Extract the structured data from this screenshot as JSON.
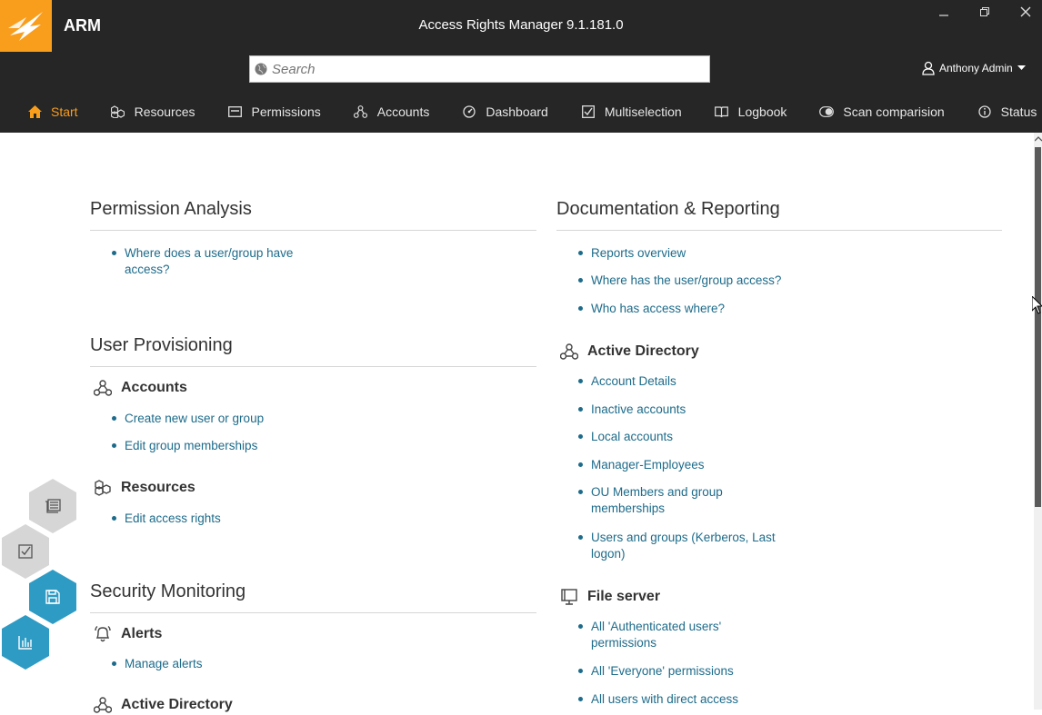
{
  "app": {
    "name": "ARM",
    "window_title": "Access Rights Manager  9.1.181.0",
    "brand_color": "#f99d1c",
    "link_color": "#1d6b8a"
  },
  "search": {
    "placeholder": "Search"
  },
  "user": {
    "name": "Anthony Admin"
  },
  "nav": [
    {
      "label": "Start",
      "icon": "home-icon",
      "active": true
    },
    {
      "label": "Resources",
      "icon": "resources-icon"
    },
    {
      "label": "Permissions",
      "icon": "permissions-icon"
    },
    {
      "label": "Accounts",
      "icon": "accounts-icon"
    },
    {
      "label": "Dashboard",
      "icon": "dashboard-icon"
    },
    {
      "label": "Multiselection",
      "icon": "checkbox-icon"
    },
    {
      "label": "Logbook",
      "icon": "book-icon"
    },
    {
      "label": "Scan comparision",
      "icon": "toggle-icon"
    },
    {
      "label": "Status",
      "icon": "info-icon"
    }
  ],
  "left": {
    "permission_analysis": {
      "title": "Permission Analysis",
      "links": [
        "Where does a user/group have",
        "access?"
      ]
    },
    "user_provisioning": {
      "title": "User Provisioning",
      "accounts": {
        "title": "Accounts",
        "links": [
          "Create new user or group",
          "Edit group memberships"
        ]
      },
      "resources": {
        "title": "Resources",
        "links": [
          "Edit access rights"
        ]
      }
    },
    "security_monitoring": {
      "title": "Security Monitoring",
      "alerts": {
        "title": "Alerts",
        "links": [
          "Manage alerts"
        ]
      },
      "active_directory": {
        "title": "Active Directory"
      }
    }
  },
  "right": {
    "documentation": {
      "title": "Documentation & Reporting",
      "links": [
        "Reports overview",
        "Where has the user/group access?",
        "Who has access where?"
      ]
    },
    "active_directory": {
      "title": "Active Directory",
      "links": [
        "Account Details",
        "Inactive accounts",
        "Local accounts",
        "Manager-Employees",
        "OU Members and group",
        "memberships",
        "Users and groups (Kerberos, Last",
        "logon)"
      ]
    },
    "file_server": {
      "title": "File server",
      "links": [
        "All 'Authenticated users'",
        "permissions",
        "All 'Everyone' permissions",
        "All users with direct access"
      ]
    }
  }
}
